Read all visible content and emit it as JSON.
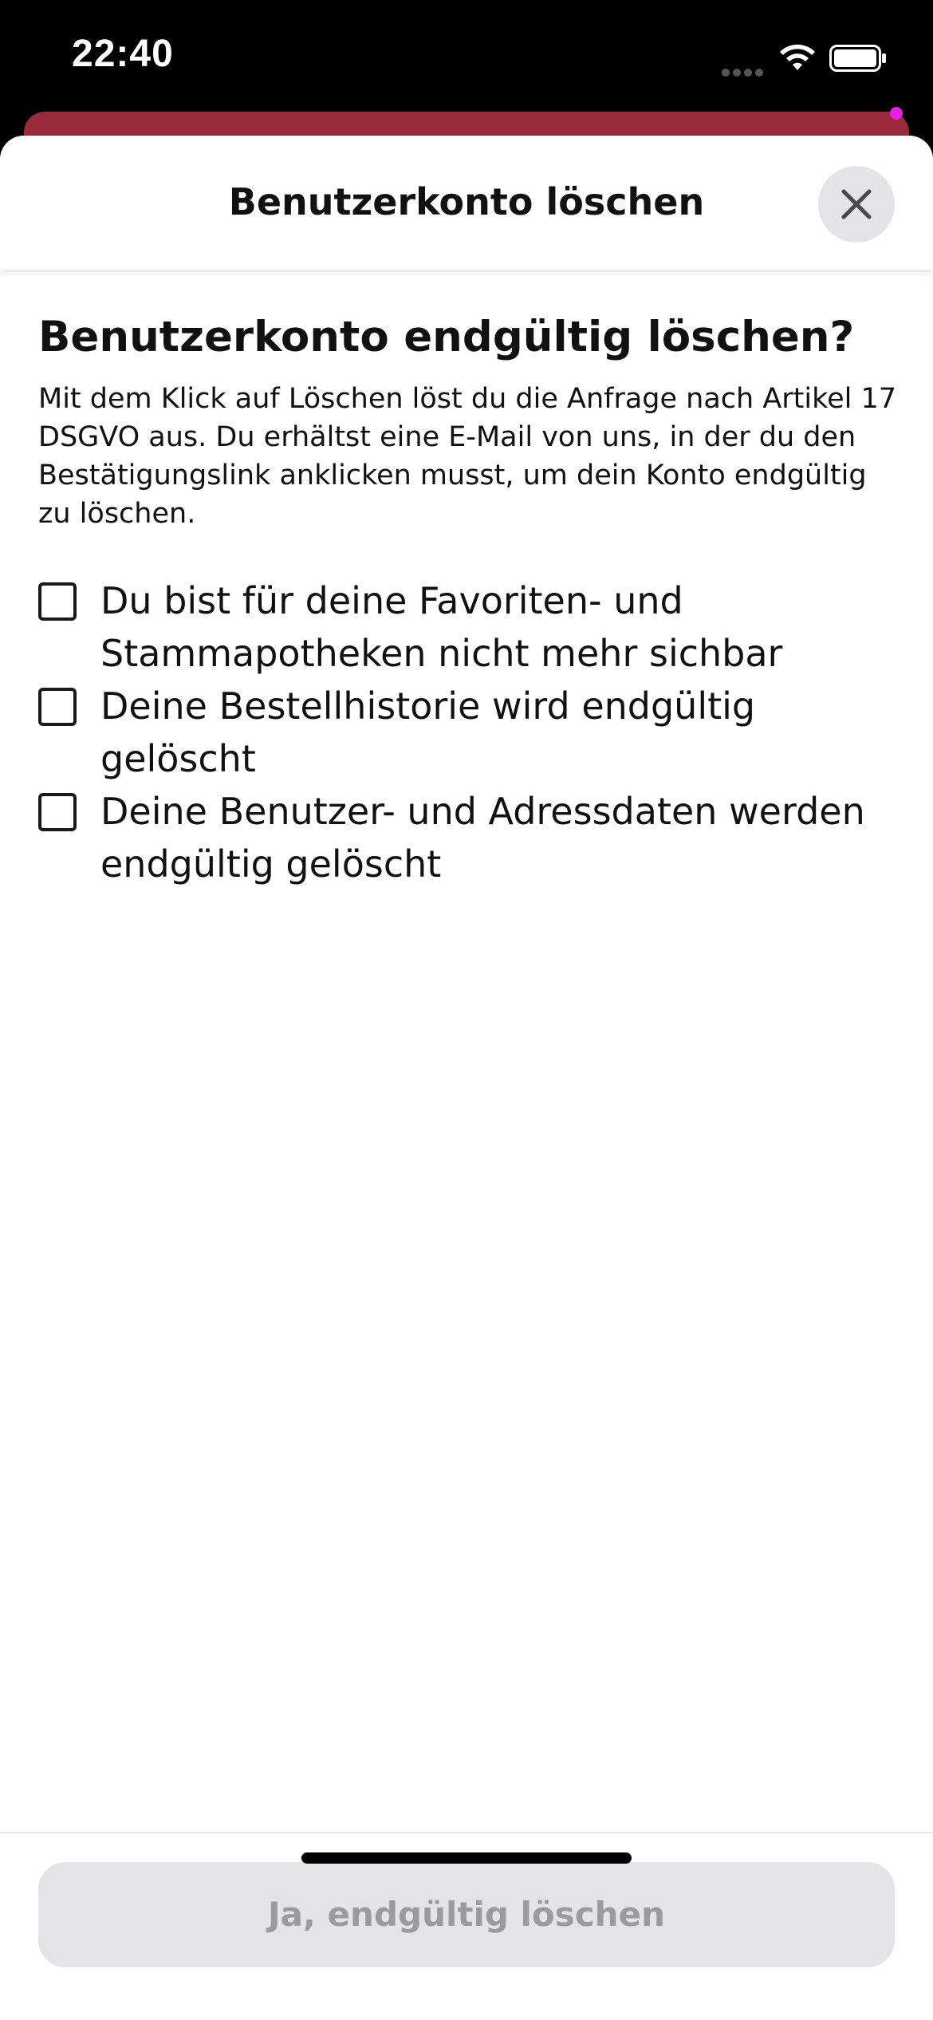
{
  "status_bar": {
    "time": "22:40"
  },
  "header": {
    "title": "Benutzerkonto löschen",
    "close_icon": "close-icon"
  },
  "content": {
    "heading": "Benutzerkonto endgültig löschen?",
    "description": "Mit dem Klick auf Löschen löst du die Anfrage nach Artikel 17 DSGVO aus. Du erhältst eine E-Mail von uns, in der du den Bestätigungslink anklicken musst, um dein Konto endgültig zu löschen.",
    "checkboxes": [
      {
        "label": "Du bist für deine Favoriten- und Stammapotheken nicht mehr sichbar",
        "checked": false
      },
      {
        "label": "Deine Bestellhistorie wird endgültig gelöscht",
        "checked": false
      },
      {
        "label": "Deine Benutzer- und Adressdaten werden endgültig gelöscht",
        "checked": false
      }
    ]
  },
  "footer": {
    "confirm_label": "Ja, endgültig löschen",
    "confirm_enabled": false
  },
  "colors": {
    "background_card": "#9b2a3b",
    "notification_dot": "#e61ee6",
    "button_disabled_bg": "#e4e4e6",
    "button_disabled_text": "#9b9b9f"
  }
}
